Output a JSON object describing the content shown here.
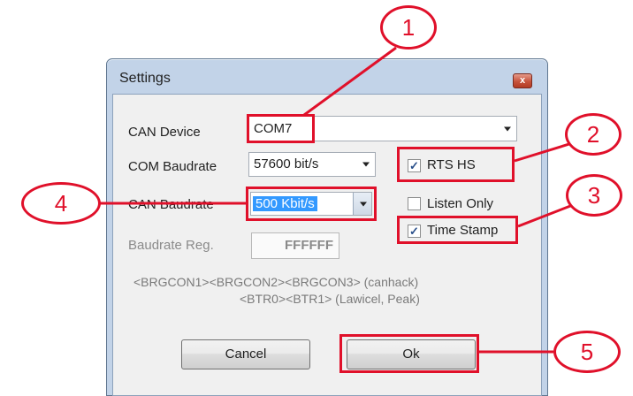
{
  "window": {
    "title": "Settings",
    "close_glyph": "x"
  },
  "can_device": {
    "label": "CAN Device",
    "value": "COM7"
  },
  "com_baudrate": {
    "label": "COM Baudrate",
    "value": "57600 bit/s"
  },
  "can_baudrate": {
    "label": "CAN Baudrate",
    "value": "500 Kbit/s"
  },
  "baudrate_reg": {
    "label": "Baudrate Reg.",
    "value": "FFFFFF"
  },
  "checkboxes": {
    "rts_hs": {
      "label": "RTS HS",
      "checked": true
    },
    "listen_only": {
      "label": "Listen Only",
      "checked": false
    },
    "time_stamp": {
      "label": "Time Stamp",
      "checked": true
    }
  },
  "hint": {
    "line1": "<BRGCON1><BRGCON2><BRGCON3> (canhack)",
    "line2": "<BTR0><BTR1> (Lawicel, Peak)"
  },
  "buttons": {
    "cancel": "Cancel",
    "ok": "Ok"
  },
  "callouts": [
    "1",
    "2",
    "3",
    "4",
    "5"
  ],
  "colors": {
    "callout": "#e0102a",
    "selection": "#3399ff",
    "frame": "#c2d3e8"
  }
}
